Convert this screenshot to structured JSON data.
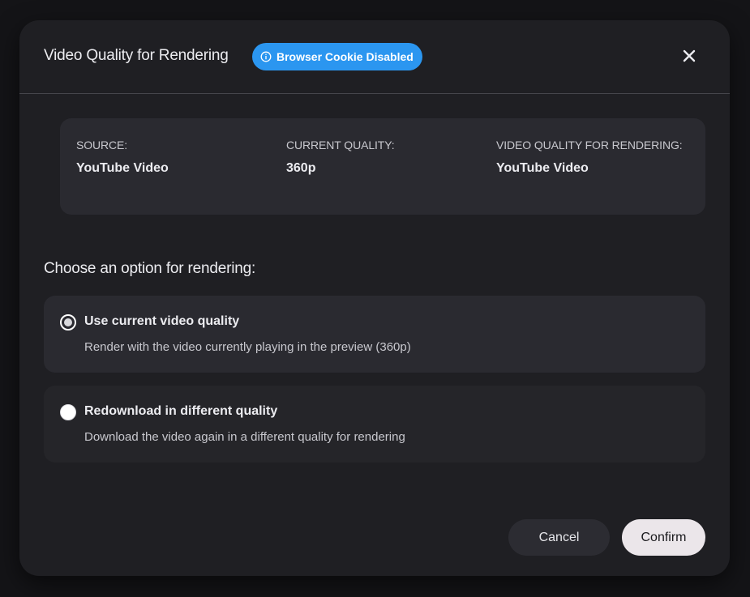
{
  "dialog": {
    "title": "Video Quality for Rendering",
    "badge": {
      "label": "Browser Cookie Disabled",
      "icon": "info-icon",
      "color": "#2b96f0"
    },
    "close_icon": "close-icon"
  },
  "info": {
    "source": {
      "label": "SOURCE:",
      "value": "YouTube Video"
    },
    "current_quality": {
      "label": "CURRENT QUALITY:",
      "value": "360p"
    },
    "render_quality": {
      "label": "VIDEO QUALITY FOR RENDERING:",
      "value": "YouTube Video"
    }
  },
  "options": {
    "heading": "Choose an option for rendering:",
    "items": [
      {
        "title": "Use current video quality",
        "description": "Render with the video currently playing in the preview (360p)",
        "selected": true
      },
      {
        "title": "Redownload in different quality",
        "description": "Download the video again in a different quality for rendering",
        "selected": false
      }
    ]
  },
  "footer": {
    "cancel_label": "Cancel",
    "confirm_label": "Confirm"
  },
  "colors": {
    "backdrop": "#141417",
    "modal": "#1f1f23",
    "card": "#2a2a30",
    "accent": "#2b96f0",
    "confirm_bg": "#ebe6ea"
  }
}
